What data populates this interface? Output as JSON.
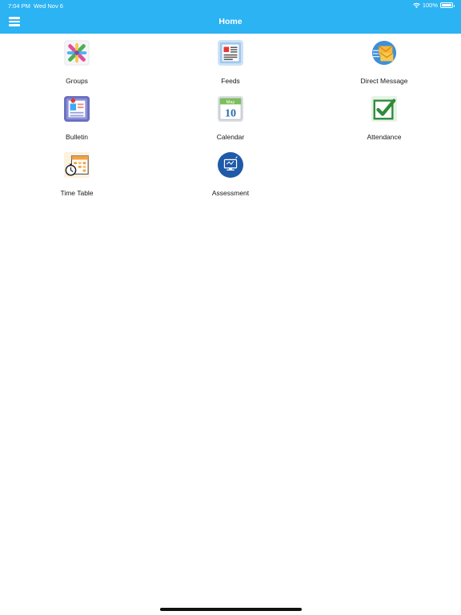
{
  "status": {
    "time": "7:04 PM",
    "date": "Wed Nov 6",
    "battery": "100%"
  },
  "header": {
    "title": "Home"
  },
  "tiles": [
    {
      "label": "Groups"
    },
    {
      "label": "Feeds"
    },
    {
      "label": "Direct Message"
    },
    {
      "label": "Bulletin"
    },
    {
      "label": "Calendar",
      "icon_text": {
        "month": "May",
        "day": "10"
      }
    },
    {
      "label": "Attendance"
    },
    {
      "label": "Time Table"
    },
    {
      "label": "Assessment"
    }
  ],
  "colors": {
    "header": "#2bb3f3",
    "assessment_circle": "#1f5aa8",
    "attendance_check": "#2e8b3a"
  }
}
